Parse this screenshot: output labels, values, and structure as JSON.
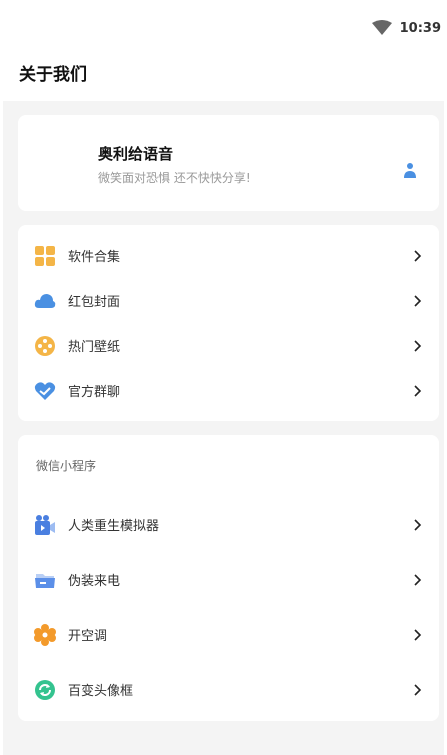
{
  "status_bar": {
    "time": "10:39",
    "wifi_icon": "wifi-icon"
  },
  "header": {
    "title": "关于我们"
  },
  "profile": {
    "app_name": "奥利给语音",
    "slogan": "微笑面对恐惧 还不快快分享!",
    "icon": "user-icon"
  },
  "menu": {
    "items": [
      {
        "label": "软件合集",
        "icon": "grid-apps-icon",
        "color": "#F4B547"
      },
      {
        "label": "红包封面",
        "icon": "cloud-icon",
        "color": "#4A90E2"
      },
      {
        "label": "热门壁纸",
        "icon": "film-reel-icon",
        "color": "#F4B547"
      },
      {
        "label": "官方群聊",
        "icon": "heart-chat-icon",
        "color": "#4A90E2"
      }
    ]
  },
  "mini_programs": {
    "section_title": "微信小程序",
    "items": [
      {
        "label": "人类重生模拟器",
        "icon": "video-camera-icon",
        "color": "#4A7FE0"
      },
      {
        "label": "伪装来电",
        "icon": "folder-icon",
        "color": "#5B8FE8"
      },
      {
        "label": "开空调",
        "icon": "flower-gear-icon",
        "color": "#F39A2B"
      },
      {
        "label": "百变头像框",
        "icon": "refresh-circle-icon",
        "color": "#34C38F"
      }
    ]
  }
}
